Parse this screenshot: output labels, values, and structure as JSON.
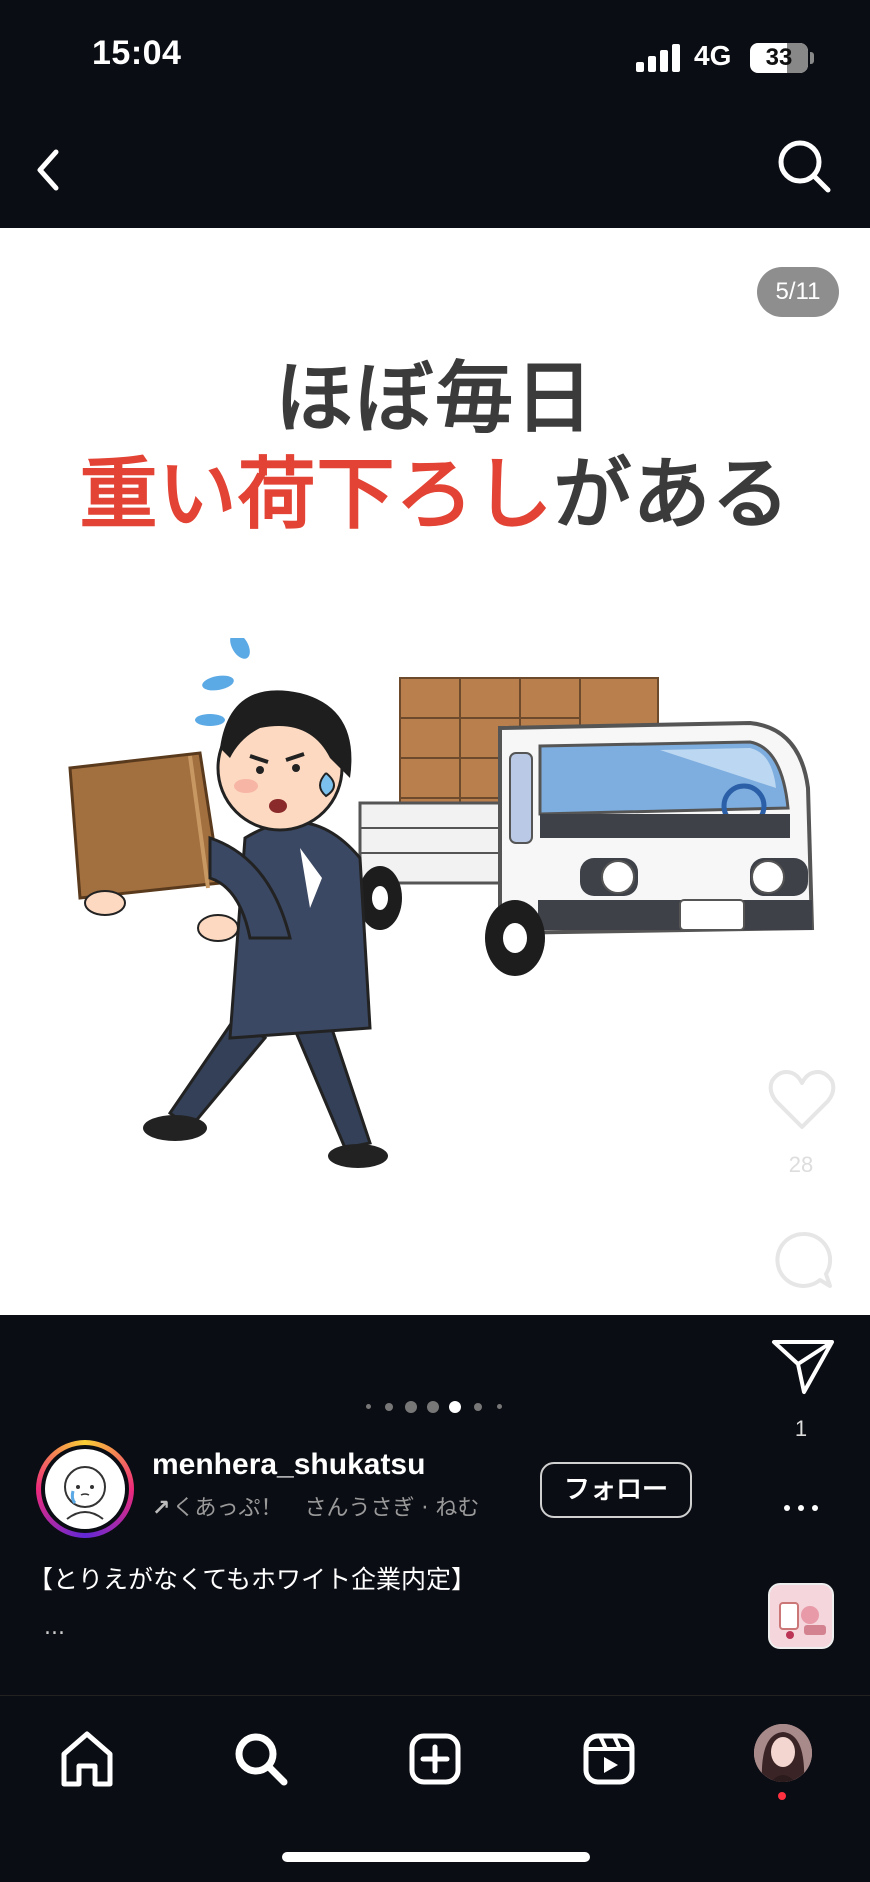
{
  "status_bar": {
    "time": "15:04",
    "network": "4G",
    "battery": "33"
  },
  "header": {
    "back_icon": "chevron-left-icon",
    "search_icon": "search-icon"
  },
  "post": {
    "page_counter": "5/11",
    "headline_line1": "ほぼ毎日",
    "headline_line2_highlight": "重い荷下ろし",
    "headline_line2_rest": "がある",
    "highlight_color": "#e34334",
    "carousel_total_dots": 7,
    "carousel_active_index": 4
  },
  "actions": {
    "like_count": "28",
    "share_count": "1"
  },
  "author": {
    "username": "menhera_shukatsu",
    "music_text": "くあっぷ！　さんうさぎ · ねむ",
    "follow_label": "フォロー"
  },
  "caption": {
    "text": "【とりえがなくてもホワイト企業内定】",
    "more": "..."
  },
  "tab_bar": {
    "items": [
      "home-icon",
      "search-icon",
      "create-icon",
      "reels-icon",
      "profile-avatar"
    ]
  }
}
